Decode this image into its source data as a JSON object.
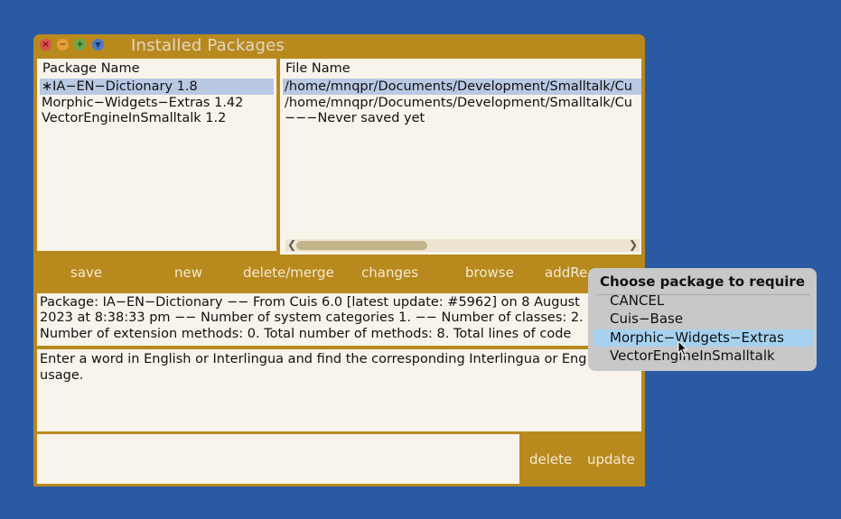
{
  "window": {
    "title": "Installed Packages",
    "controls": [
      "close-icon",
      "minimize-icon",
      "maximize-icon",
      "menu-icon"
    ]
  },
  "package_list": {
    "header": "Package Name",
    "items": [
      "∗IA−EN−Dictionary 1.8",
      "Morphic−Widgets−Extras 1.42",
      "VectorEngineInSmalltalk 1.2"
    ],
    "selected_index": 0
  },
  "file_list": {
    "header": "File Name",
    "items": [
      "/home/mnqpr/Documents/Development/Smalltalk/Cu",
      "/home/mnqpr/Documents/Development/Smalltalk/Cu",
      "−−−Never saved yet"
    ],
    "selected_index": 0
  },
  "toolbar": {
    "save": "save",
    "new": "new",
    "delete_merge": "delete/merge",
    "changes": "changes",
    "browse": "browse",
    "add_requirement": "addRe"
  },
  "info": {
    "line1": "Package: IA−EN−Dictionary −− From Cuis 6.0 [latest update: #5962] on 8 August",
    "line2": "2023 at 8:38:33 pm −− Number of system categories 1. −− Number of classes: 2.",
    "line3": "Number of extension methods: 0. Total number of methods: 8. Total lines of code"
  },
  "description": {
    "line1": "Enter a word in English or Interlingua and find the corresponding Interlingua or Eng",
    "line2": "usage."
  },
  "requirements": {
    "delete": "delete",
    "update": "update"
  },
  "popup": {
    "title": "Choose package to require",
    "items": [
      "CANCEL",
      "Cuis−Base",
      "Morphic−Widgets−Extras",
      "VectorEngineInSmalltalk"
    ],
    "highlighted_index": 2
  },
  "colors": {
    "desktop": "#2b5aa5",
    "window_frame": "#b8891d",
    "pane_background": "#f8f4eb",
    "selection": "#b9c9e4",
    "popup_background": "#c8c8c8",
    "popup_highlight": "#a6d1ef"
  }
}
